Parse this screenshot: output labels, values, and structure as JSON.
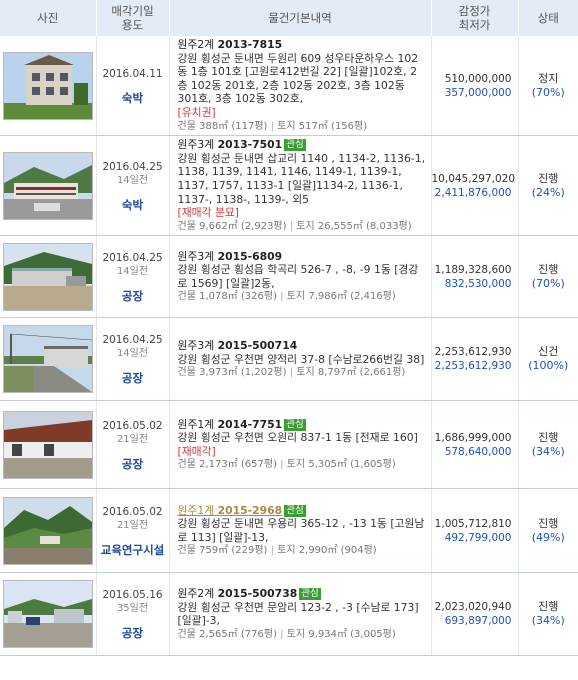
{
  "header": {
    "photo": "사진",
    "date_use": [
      "매각기일",
      "용도"
    ],
    "info": "물건기본내역",
    "price": [
      "감정가",
      "최저가"
    ],
    "status": "상태"
  },
  "rows": [
    {
      "date": "2016.04.11",
      "ago": "",
      "use": "숙박",
      "court": "원주2계",
      "case_no": "2013-7815",
      "tag": "",
      "visited": false,
      "address": "강원 횡성군 둔내면 두원리 609 성우타운하우스 102동 1층 101호 [고원로412번길 22] [일괄]102호, 2층 102동 201호, 2층 102동 202호, 3층 102동 301호, 3층 102동 302호,",
      "note": "[유치권]",
      "bldg_label": "건물",
      "bldg_area": "388㎡ (117평)",
      "land_label": "토지",
      "land_area": "517㎡ (156평)",
      "appraisal": "510,000,000",
      "minimum": "357,000,000",
      "status": "정지",
      "pct": "(70%)",
      "photo": "photo-townhouse"
    },
    {
      "date": "2016.04.25",
      "ago": "14일전",
      "use": "숙박",
      "court": "원주3계",
      "case_no": "2013-7501",
      "tag": "관심",
      "visited": false,
      "address": "강원 횡성군 둔내면 삽교리 1140 , 1134-2, 1136-1, 1138, 1139, 1141, 1146, 1149-1, 1139-1, 1137, 1757, 1133-1 [일괄]1134-2, 1136-1, 1137-, 1138-, 1139-, 외5",
      "note": "[재매각 분묘]",
      "bldg_label": "건물",
      "bldg_area": "9,662㎡ (2,923평)",
      "land_label": "토지",
      "land_area": "26,555㎡ (8,033평)",
      "appraisal": "10,045,297,020",
      "minimum": "2,411,876,000",
      "status": "진행",
      "pct": "(24%)",
      "photo": "photo-resort"
    },
    {
      "date": "2016.04.25",
      "ago": "14일전",
      "use": "공장",
      "court": "원주3계",
      "case_no": "2015-6809",
      "tag": "",
      "visited": false,
      "address": "강원 횡성군 횡성읍 학곡리 526-7 , -8, -9 1동 [경강로 1569] [일괄]2동,",
      "note": "",
      "bldg_label": "건물",
      "bldg_area": "1,078㎡ (326평)",
      "land_label": "토지",
      "land_area": "7,986㎡ (2,416평)",
      "appraisal": "1,189,328,600",
      "minimum": "832,530,000",
      "status": "진행",
      "pct": "(70%)",
      "photo": "photo-factory-hill"
    },
    {
      "date": "2016.04.25",
      "ago": "14일전",
      "use": "공장",
      "court": "원주3계",
      "case_no": "2015-500714",
      "tag": "",
      "visited": false,
      "address": "강원 횡성군 우천면 양적리 37-8 [수남로266번길 38]",
      "note": "",
      "bldg_label": "건물",
      "bldg_area": "3,973㎡ (1,202평)",
      "land_label": "토지",
      "land_area": "8,797㎡ (2,661평)",
      "appraisal": "2,253,612,930",
      "minimum": "2,253,612,930",
      "status": "신건",
      "pct": "(100%)",
      "photo": "photo-factory-road"
    },
    {
      "date": "2016.05.02",
      "ago": "21일전",
      "use": "공장",
      "court": "원주1계",
      "case_no": "2014-7751",
      "tag": "관심",
      "visited": false,
      "address": "강원 횡성군 우천면 오원리 837-1 1동 [전재로 160]",
      "note": "[재매각]",
      "bldg_label": "건물",
      "bldg_area": "2,173㎡ (657평)",
      "land_label": "토지",
      "land_area": "5,305㎡ (1,605평)",
      "appraisal": "1,686,999,000",
      "minimum": "578,640,000",
      "status": "진행",
      "pct": "(34%)",
      "photo": "photo-shed"
    },
    {
      "date": "2016.05.02",
      "ago": "21일전",
      "use": "교육연구시설",
      "court": "원주1계",
      "case_no": "2015-2968",
      "tag": "관심",
      "visited": true,
      "address": "강원 횡성군 둔내면 우용리 365-12 , -13 1동 [고원남로 113] [일괄]-13,",
      "note": "",
      "bldg_label": "건물",
      "bldg_area": "759㎡ (229평)",
      "land_label": "토지",
      "land_area": "2,990㎡ (904평)",
      "appraisal": "1,005,712,810",
      "minimum": "492,799,000",
      "status": "진행",
      "pct": "(49%)",
      "photo": "photo-mountain"
    },
    {
      "date": "2016.05.16",
      "ago": "35일전",
      "use": "공장",
      "court": "원주2계",
      "case_no": "2015-500738",
      "tag": "관심",
      "visited": false,
      "address": "강원 횡성군 우천면 문암리 123-2 , -3 [수남로 173] [일괄]-3,",
      "note": "",
      "bldg_label": "건물",
      "bldg_area": "2,565㎡ (776평)",
      "land_label": "토지",
      "land_area": "9,934㎡ (3,005평)",
      "appraisal": "2,023,020,940",
      "minimum": "693,897,000",
      "status": "진행",
      "pct": "(34%)",
      "photo": "photo-yard"
    }
  ]
}
